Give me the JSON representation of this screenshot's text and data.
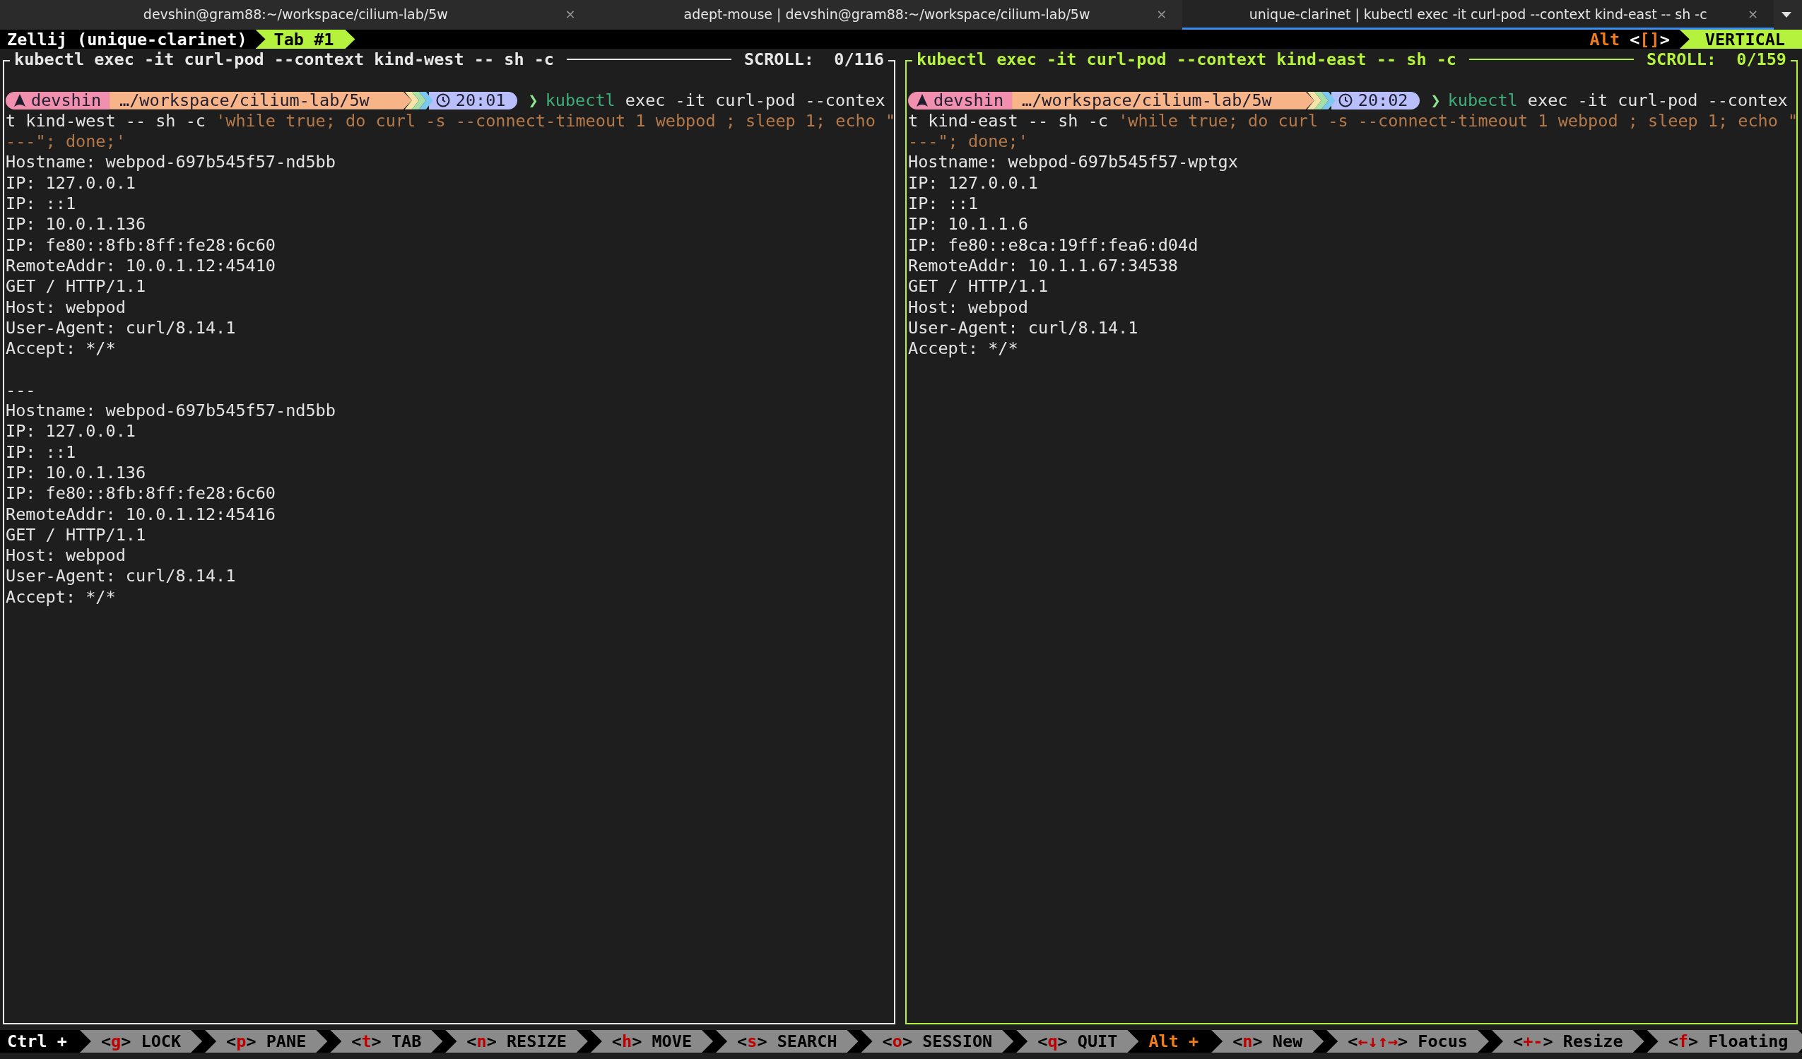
{
  "browser_tabs": [
    {
      "title": "devshin@gram88:~/workspace/cilium-lab/5w",
      "selected": false,
      "close": "×"
    },
    {
      "title": "adept-mouse | devshin@gram88:~/workspace/cilium-lab/5w",
      "selected": false,
      "close": "×"
    },
    {
      "title": "unique-clarinet | kubectl exec -it curl-pod --context kind-east -- sh -c",
      "selected": true,
      "close": "×"
    }
  ],
  "zellij": {
    "session": "Zellij (unique-clarinet)",
    "tabs": [
      {
        "label": "Tab #1",
        "selected": true
      }
    ],
    "alt_hint": {
      "label": "Alt",
      "open": "<",
      "key": "[]",
      "close": ">"
    },
    "layout": "VERTICAL"
  },
  "panes": [
    {
      "title": "kubectl exec -it curl-pod --context kind-west -- sh -c",
      "scroll": "SCROLL:  0/116",
      "focused": false,
      "prompt": {
        "user": "devshin",
        "path": "…/workspace/cilium-lab/5w",
        "time": "20:01",
        "symbol": "❯",
        "command": "kubectl",
        "args": "exec -it curl-pod --contex"
      },
      "wrapped": [
        [
          {
            "text": "t kind-west -- sh -c ",
            "kind": "plain"
          },
          {
            "text": "'while true; do curl -s --connect-timeout 1 webpod ; sleep 1; echo \"",
            "kind": "string"
          }
        ],
        [
          {
            "text": "---\"; done;'",
            "kind": "string"
          }
        ]
      ],
      "output": [
        [
          "Hostname: webpod-697b545f57-nd5bb",
          "IP: 127.0.0.1",
          "IP: ::1",
          "IP: 10.0.1.136",
          "IP: fe80::8fb:8ff:fe28:6c60",
          "RemoteAddr: 10.0.1.12:45410",
          "GET / HTTP/1.1",
          "Host: webpod",
          "User-Agent: curl/8.14.1",
          "Accept: */*"
        ],
        [
          "---",
          "Hostname: webpod-697b545f57-nd5bb",
          "IP: 127.0.0.1",
          "IP: ::1",
          "IP: 10.0.1.136",
          "IP: fe80::8fb:8ff:fe28:6c60",
          "RemoteAddr: 10.0.1.12:45416",
          "GET / HTTP/1.1",
          "Host: webpod",
          "User-Agent: curl/8.14.1",
          "Accept: */*"
        ]
      ]
    },
    {
      "title": "kubectl exec -it curl-pod --context kind-east -- sh -c",
      "scroll": "SCROLL:  0/159",
      "focused": true,
      "prompt": {
        "user": "devshin",
        "path": "…/workspace/cilium-lab/5w",
        "time": "20:02",
        "symbol": "❯",
        "command": "kubectl",
        "args": "exec -it curl-pod --contex"
      },
      "wrapped": [
        [
          {
            "text": "t kind-east -- sh -c ",
            "kind": "plain"
          },
          {
            "text": "'while true; do curl -s --connect-timeout 1 webpod ; sleep 1; echo \"",
            "kind": "string"
          }
        ],
        [
          {
            "text": "---\"; done;'",
            "kind": "string"
          }
        ]
      ],
      "output": [
        [
          "Hostname: webpod-697b545f57-wptgx",
          "IP: 127.0.0.1",
          "IP: ::1",
          "IP: 10.1.1.6",
          "IP: fe80::e8ca:19ff:fea6:d04d",
          "RemoteAddr: 10.1.1.67:34538",
          "GET / HTTP/1.1",
          "Host: webpod",
          "User-Agent: curl/8.14.1",
          "Accept: */*"
        ]
      ]
    }
  ],
  "status_bar": {
    "key_open": "<",
    "key_close": ">",
    "ctrl": {
      "label": "Ctrl +",
      "items": [
        {
          "key": "g",
          "label": "LOCK"
        },
        {
          "key": "p",
          "label": "PANE"
        },
        {
          "key": "t",
          "label": "TAB"
        },
        {
          "key": "n",
          "label": "RESIZE"
        },
        {
          "key": "h",
          "label": "MOVE"
        },
        {
          "key": "s",
          "label": "SEARCH"
        },
        {
          "key": "o",
          "label": "SESSION"
        },
        {
          "key": "q",
          "label": "QUIT"
        }
      ]
    },
    "alt": {
      "label": "Alt +",
      "items": [
        {
          "key": "n",
          "label": "New"
        },
        {
          "key": "←↓↑→",
          "label": "Focus"
        },
        {
          "key": "+-",
          "label": "Resize"
        },
        {
          "key": "f",
          "label": "Floating"
        }
      ]
    }
  }
}
